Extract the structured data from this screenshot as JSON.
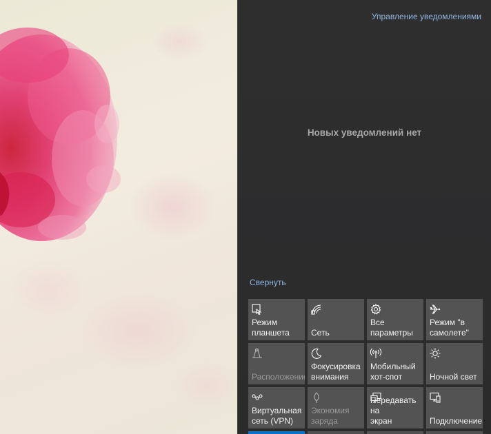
{
  "action_center": {
    "manage_notifications": "Управление уведомлениями",
    "empty_message": "Новых уведомлений нет",
    "collapse": "Свернуть"
  },
  "quick_actions": [
    {
      "label": "Режим\nпланшета",
      "icon": "tablet-mode-icon",
      "enabled": true
    },
    {
      "label": "Сеть",
      "icon": "network-icon",
      "enabled": true
    },
    {
      "label": "Все параметры",
      "icon": "gear-icon",
      "enabled": true
    },
    {
      "label": "Режим \"в\nсамолете\"",
      "icon": "airplane-icon",
      "enabled": true
    },
    {
      "label": "Расположение",
      "icon": "location-icon",
      "enabled": false
    },
    {
      "label": "Фокусировка\nвнимания",
      "icon": "moon-icon",
      "enabled": true
    },
    {
      "label": "Мобильный\nхот-спот",
      "icon": "hotspot-icon",
      "enabled": true
    },
    {
      "label": "Ночной свет",
      "icon": "night-light-icon",
      "enabled": true
    },
    {
      "label": "Виртуальная\nсеть (VPN)",
      "icon": "vpn-icon",
      "enabled": true
    },
    {
      "label": "Экономия\nзаряда",
      "icon": "battery-saver-icon",
      "enabled": false
    },
    {
      "label": "Передавать на\nэкран",
      "icon": "project-icon",
      "enabled": true
    },
    {
      "label": "Подключение",
      "icon": "connect-icon",
      "enabled": true
    }
  ],
  "colors": {
    "panel_bg": "#2b2b2c",
    "tile_bg": "#535353",
    "link": "#8fb6df",
    "accent": "#0a72c9"
  }
}
